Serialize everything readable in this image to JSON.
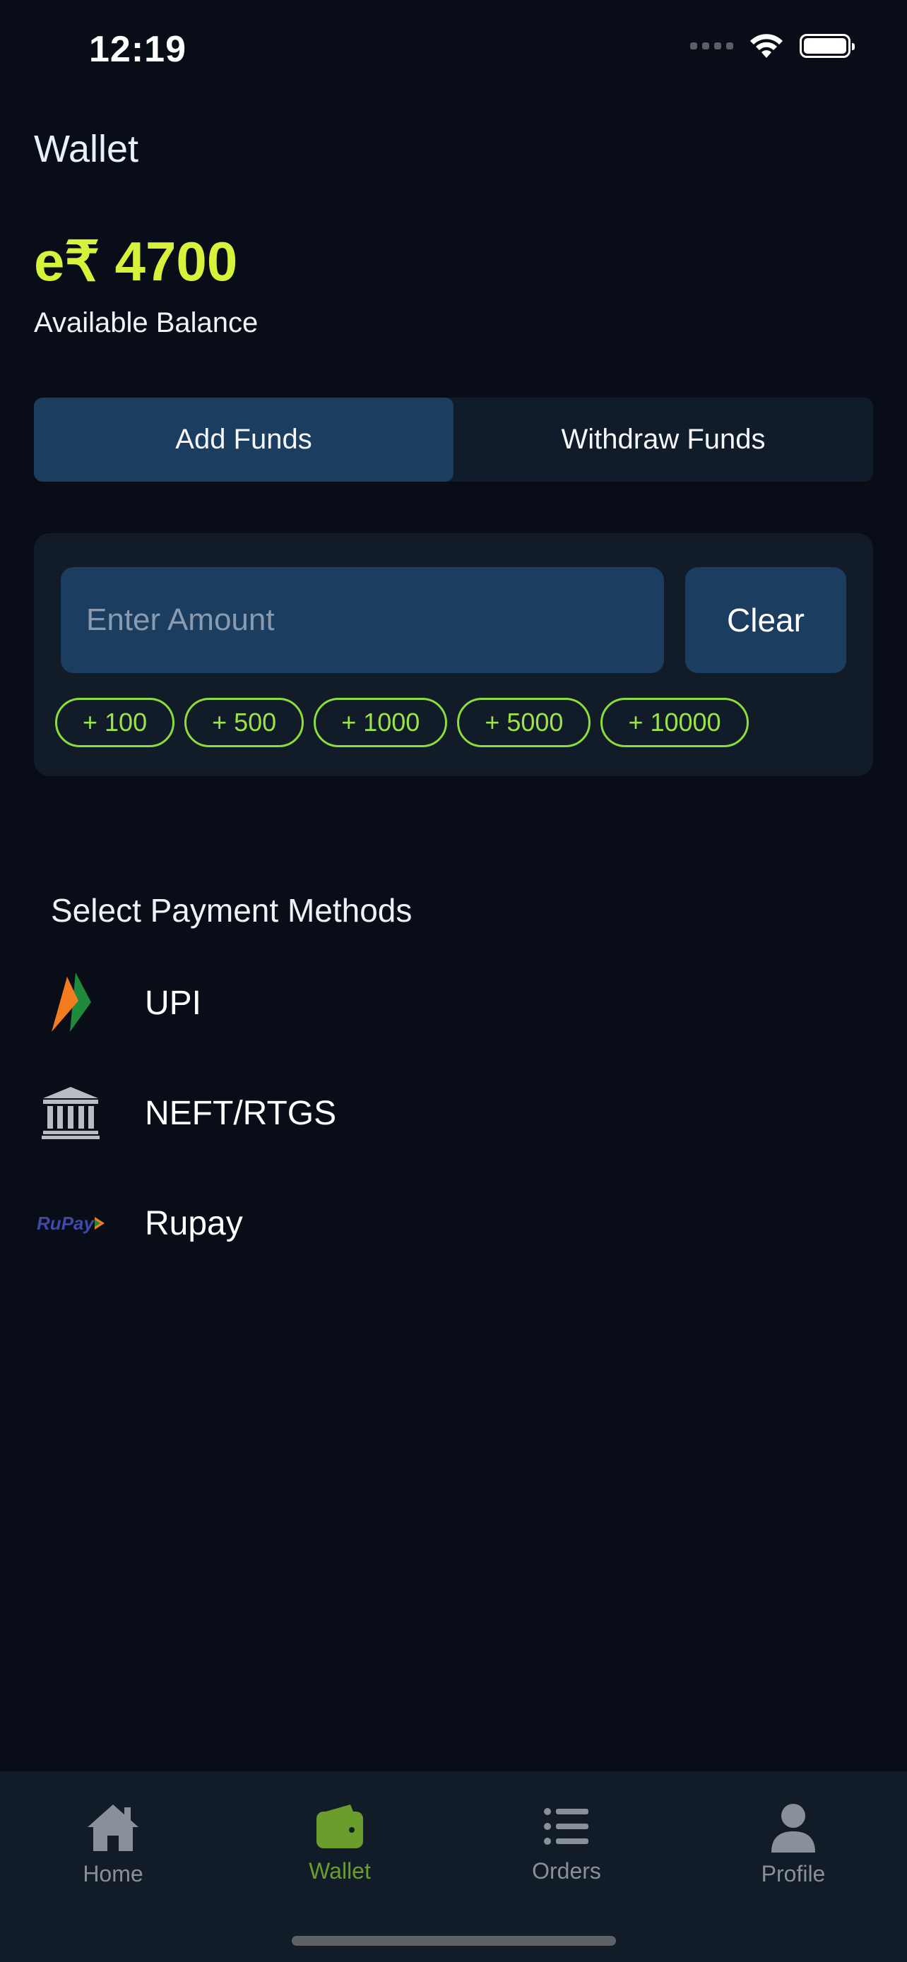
{
  "status_bar": {
    "time": "12:19"
  },
  "header": {
    "title": "Wallet"
  },
  "balance": {
    "amount": "e₹ 4700",
    "label": "Available Balance"
  },
  "fund_tabs": [
    {
      "label": "Add Funds",
      "active": true
    },
    {
      "label": "Withdraw Funds",
      "active": false
    }
  ],
  "amount_form": {
    "input_value": "",
    "input_placeholder": "Enter Amount",
    "clear_label": "Clear",
    "quick_amounts": [
      "+ 100",
      "+ 500",
      "+ 1000",
      "+ 5000",
      "+ 10000"
    ]
  },
  "payment": {
    "title": "Select Payment Methods",
    "methods": [
      {
        "label": "UPI",
        "icon": "upi-logo-icon"
      },
      {
        "label": "NEFT/RTGS",
        "icon": "bank-icon"
      },
      {
        "label": "Rupay",
        "icon": "rupay-logo-icon",
        "logo_text": "RuPay"
      }
    ]
  },
  "bottom_nav": {
    "items": [
      {
        "label": "Home",
        "icon": "home-icon",
        "active": false
      },
      {
        "label": "Wallet",
        "icon": "wallet-icon",
        "active": true
      },
      {
        "label": "Orders",
        "icon": "list-icon",
        "active": false
      },
      {
        "label": "Profile",
        "icon": "person-icon",
        "active": false
      }
    ]
  },
  "colors": {
    "background": "#080d17",
    "accent_yellow": "#d6f23a",
    "accent_green": "#8bdc3c",
    "panel": "#121c28",
    "button_blue": "#1b3d5f",
    "nav_active": "#6a9d2c",
    "nav_inactive": "#8a9099"
  }
}
